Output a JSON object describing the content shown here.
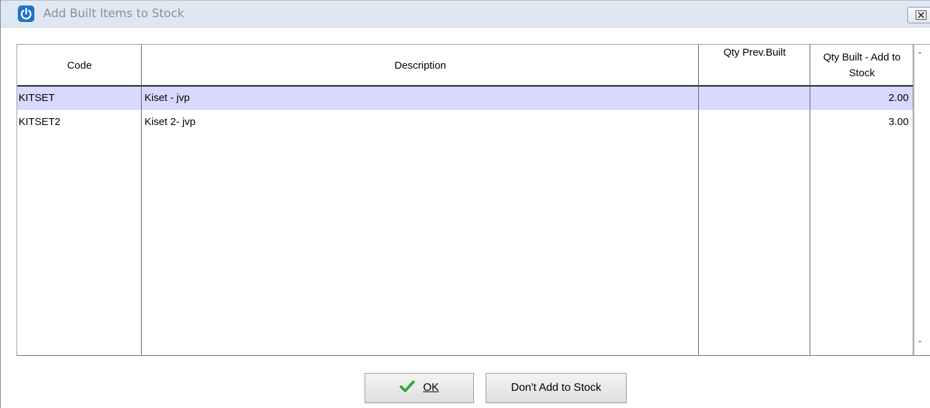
{
  "window": {
    "title": "Add Built Items to Stock",
    "close_icon": "close-icon"
  },
  "grid": {
    "columns": [
      {
        "key": "code",
        "label": "Code"
      },
      {
        "key": "description",
        "label": "Description"
      },
      {
        "key": "qty_prev_built",
        "label": "Qty Prev.Built"
      },
      {
        "key": "qty_built_add",
        "label": "Qty Built - Add to Stock"
      }
    ],
    "rows": [
      {
        "code": "KITSET",
        "description": "Kiset - jvp",
        "qty_prev_built": "",
        "qty_built_add": "2.00",
        "selected": true
      },
      {
        "code": "KITSET2",
        "description": "Kiset 2- jvp",
        "qty_prev_built": "",
        "qty_built_add": "3.00",
        "selected": false
      }
    ]
  },
  "buttons": {
    "ok_label": "OK",
    "ok_icon": "checkmark-icon",
    "dont_add_label": "Don't Add to Stock"
  },
  "colors": {
    "selected_row": "#d9d9ff",
    "title_bar": "#dfe7f1",
    "check_green": "#3aa53a"
  }
}
